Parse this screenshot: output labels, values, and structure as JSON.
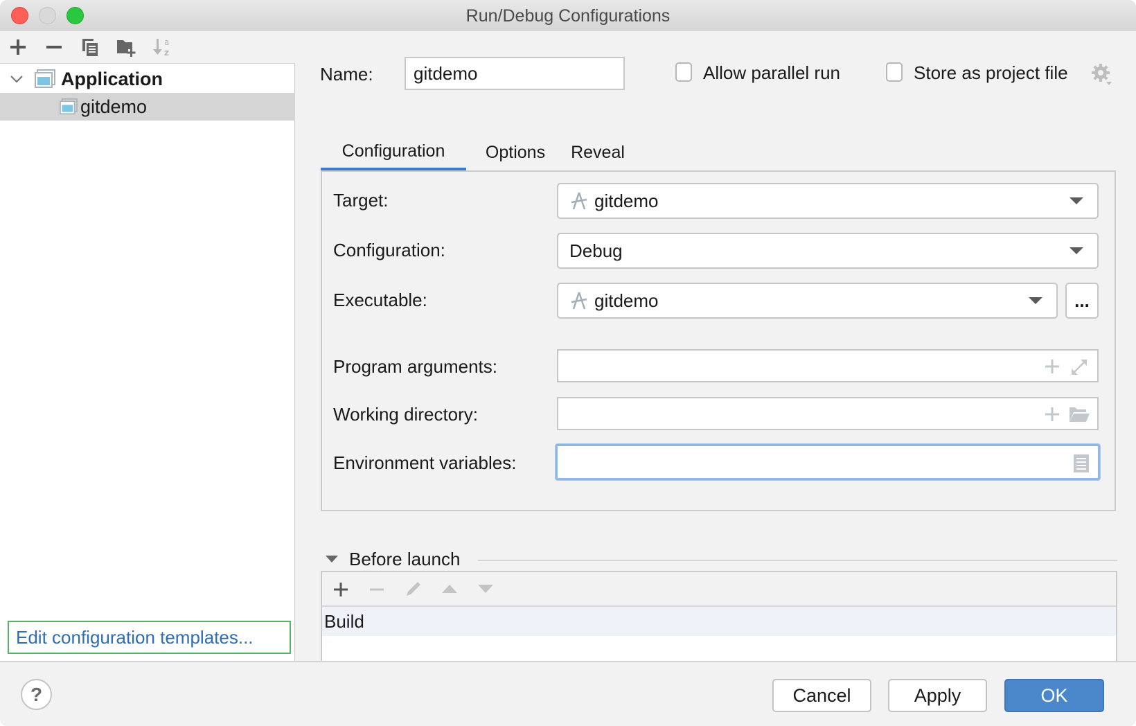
{
  "window": {
    "title": "Run/Debug Configurations"
  },
  "sidebar": {
    "toolbar": [
      {
        "icon": "add-icon",
        "label": "Add"
      },
      {
        "icon": "remove-icon",
        "label": "Remove"
      },
      {
        "icon": "copy-icon",
        "label": "Copy"
      },
      {
        "icon": "new-folder-icon",
        "label": "New folder"
      },
      {
        "icon": "sort-alpha-icon",
        "label": "Sort alphabetically"
      }
    ],
    "tree": [
      {
        "label": "Application",
        "expanded": true,
        "level": 0
      },
      {
        "label": "gitdemo",
        "selected": true,
        "level": 1
      }
    ],
    "edit_templates_link": "Edit configuration templates..."
  },
  "main": {
    "name_label": "Name:",
    "name_value": "gitdemo",
    "allow_parallel_run": {
      "label": "Allow parallel run",
      "checked": false
    },
    "store_as_project_file": {
      "label": "Store as project file",
      "checked": false
    },
    "tabs": [
      {
        "label": "Configuration",
        "active": true
      },
      {
        "label": "Options",
        "active": false
      },
      {
        "label": "Reveal",
        "active": false
      }
    ],
    "form": {
      "target": {
        "label": "Target:",
        "value": "gitdemo"
      },
      "configuration": {
        "label": "Configuration:",
        "value": "Debug"
      },
      "executable": {
        "label": "Executable:",
        "value": "gitdemo",
        "browse_label": "..."
      },
      "program_arguments": {
        "label": "Program arguments:",
        "value": ""
      },
      "working_directory": {
        "label": "Working directory:",
        "value": ""
      },
      "environment_variables": {
        "label": "Environment variables:",
        "value": ""
      }
    },
    "before_launch": {
      "title": "Before launch",
      "toolbar": [
        "add-icon",
        "remove-icon",
        "edit-icon",
        "move-up-icon",
        "move-down-icon"
      ],
      "items": [
        "Build"
      ]
    }
  },
  "footer": {
    "help_label": "?",
    "cancel_label": "Cancel",
    "apply_label": "Apply",
    "ok_label": "OK"
  },
  "colors": {
    "accent": "#4b88cb",
    "link": "#2f6db5",
    "focus_ring": "#8fb8e8",
    "link_outline": "#55b464"
  }
}
